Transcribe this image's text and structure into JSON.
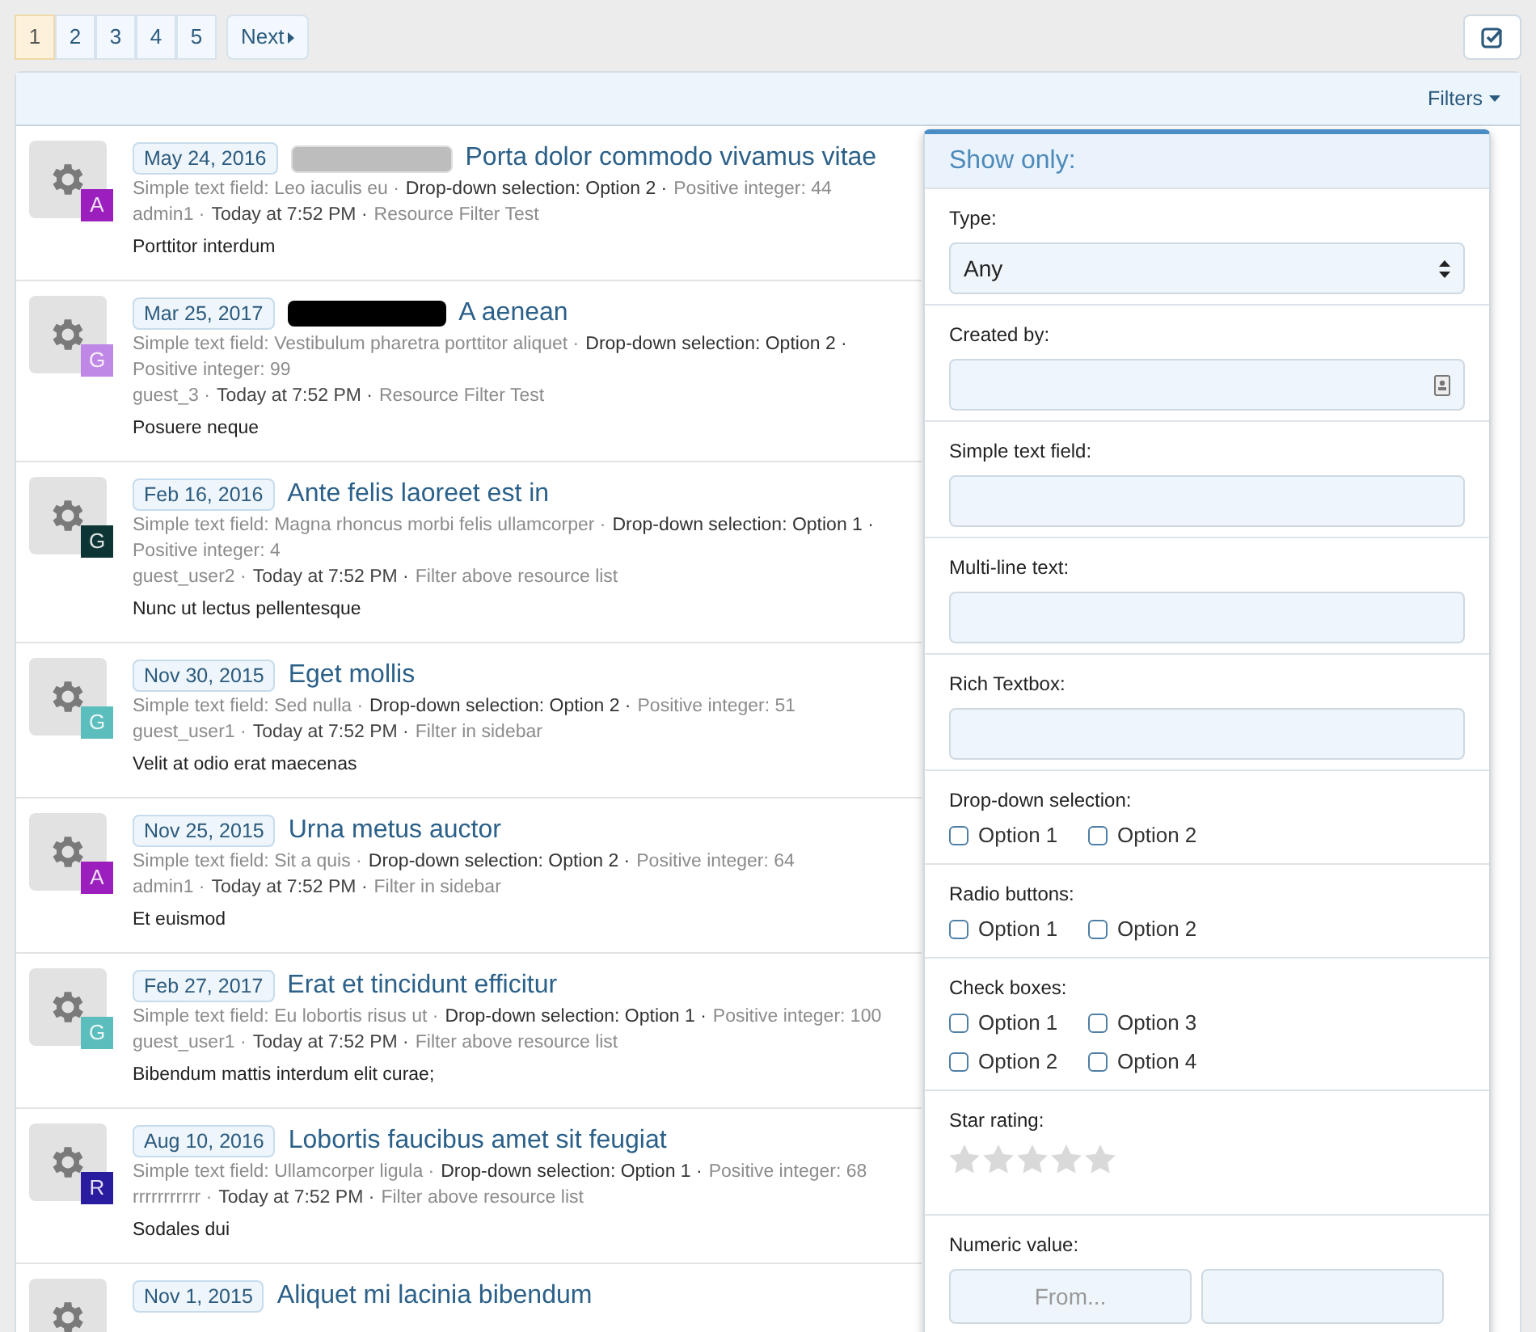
{
  "pagination": {
    "pages": [
      {
        "label": "1",
        "selected": true
      },
      {
        "label": "2",
        "selected": false
      },
      {
        "label": "3",
        "selected": false
      },
      {
        "label": "4",
        "selected": false
      },
      {
        "label": "5",
        "selected": false
      }
    ],
    "next": "Next"
  },
  "filters_toggle": "Filters",
  "resources": [
    {
      "date": "May 24, 2016",
      "redaction": {
        "kind": "light"
      },
      "title": "Porta dolor commodo vivamus vitae",
      "badge": "A",
      "color": "#9a1fbd",
      "fields": [
        {
          "kind": "text",
          "text": "Simple text field: Leo iaculis eu ·"
        },
        {
          "kind": "select",
          "text": "Drop-down selection: Option 2 ·"
        },
        {
          "kind": "integer",
          "text": "Positive integer: 44"
        }
      ],
      "author": "admin1 ·",
      "time": "Today at 7:52 PM ·",
      "category": "Resource Filter Test",
      "tagline": "Porttitor interdum"
    },
    {
      "date": "Mar 25, 2017",
      "redaction": {
        "kind": "dark"
      },
      "title": "A aenean",
      "badge": "G",
      "color": "#c088e6",
      "fields": [
        {
          "kind": "text",
          "text": "Simple text field: Vestibulum pharetra porttitor aliquet ·"
        },
        {
          "kind": "select",
          "text": "Drop-down selection: Option 2 ·"
        },
        {
          "kind": "integer",
          "text": "Positive integer: 99"
        }
      ],
      "author": "guest_3 ·",
      "time": "Today at 7:52 PM ·",
      "category": "Resource Filter Test",
      "tagline": "Posuere neque"
    },
    {
      "date": "Feb 16, 2016",
      "title": "Ante felis laoreet est in",
      "badge": "G",
      "color": "#0e3535",
      "fields": [
        {
          "kind": "text",
          "text": "Simple text field: Magna rhoncus morbi felis ullamcorper ·"
        },
        {
          "kind": "select",
          "text": "Drop-down selection: Option 1 ·"
        },
        {
          "kind": "integer",
          "text": "Positive integer: 4"
        }
      ],
      "author": "guest_user2 ·",
      "time": "Today at 7:52 PM ·",
      "category": "Filter above resource list",
      "tagline": "Nunc ut lectus pellentesque"
    },
    {
      "date": "Nov 30, 2015",
      "title": "Eget mollis",
      "badge": "G",
      "color": "#5cbdbd",
      "fields": [
        {
          "kind": "text",
          "text": "Simple text field: Sed nulla ·"
        },
        {
          "kind": "select",
          "text": "Drop-down selection: Option 2 ·"
        },
        {
          "kind": "integer",
          "text": "Positive integer: 51"
        }
      ],
      "author": "guest_user1 ·",
      "time": "Today at 7:52 PM ·",
      "category": "Filter in sidebar",
      "tagline": "Velit at odio erat maecenas"
    },
    {
      "date": "Nov 25, 2015",
      "title": "Urna metus auctor",
      "badge": "A",
      "color": "#9a1fbd",
      "fields": [
        {
          "kind": "text",
          "text": "Simple text field: Sit a quis ·"
        },
        {
          "kind": "select",
          "text": "Drop-down selection: Option 2 ·"
        },
        {
          "kind": "integer",
          "text": "Positive integer: 64"
        }
      ],
      "author": "admin1 ·",
      "time": "Today at 7:52 PM ·",
      "category": "Filter in sidebar",
      "tagline": "Et euismod"
    },
    {
      "date": "Feb 27, 2017",
      "title": "Erat et tincidunt efficitur",
      "badge": "G",
      "color": "#5cbdbd",
      "fields": [
        {
          "kind": "text",
          "text": "Simple text field: Eu lobortis risus ut ·"
        },
        {
          "kind": "select",
          "text": "Drop-down selection: Option 1 ·"
        },
        {
          "kind": "integer",
          "text": "Positive integer: 100"
        }
      ],
      "author": "guest_user1 ·",
      "time": "Today at 7:52 PM ·",
      "category": "Filter above resource list",
      "tagline": "Bibendum mattis interdum elit curae;"
    },
    {
      "date": "Aug 10, 2016",
      "title": "Lobortis faucibus amet sit feugiat",
      "badge": "R",
      "color": "#2a1c9e",
      "fields": [
        {
          "kind": "text",
          "text": "Simple text field: Ullamcorper ligula ·"
        },
        {
          "kind": "select",
          "text": "Drop-down selection: Option 1 ·"
        },
        {
          "kind": "integer",
          "text": "Positive integer: 68"
        }
      ],
      "author": "rrrrrrrrrrr ·",
      "time": "Today at 7:52 PM ·",
      "category": "Filter above resource list",
      "tagline": "Sodales dui"
    },
    {
      "date": "Nov 1, 2015",
      "title": "Aliquet mi lacinia bibendum"
    }
  ],
  "filter_panel": {
    "title": "Show only:",
    "sections": [
      {
        "kind": "select",
        "label": "Type:",
        "value": "Any"
      },
      {
        "kind": "user",
        "label": "Created by:"
      },
      {
        "kind": "input",
        "label": "Simple text field:"
      },
      {
        "kind": "input",
        "label": "Multi-line text:"
      },
      {
        "kind": "input",
        "label": "Rich Textbox:"
      },
      {
        "kind": "checks",
        "label": "Drop-down selection:",
        "options": [
          {
            "label": "Option 1",
            "checked": false
          },
          {
            "label": "Option 2",
            "checked": false
          }
        ]
      },
      {
        "kind": "checks",
        "label": "Radio buttons:",
        "options": [
          {
            "label": "Option 1",
            "checked": false
          },
          {
            "label": "Option 2",
            "checked": false
          }
        ]
      },
      {
        "kind": "checks",
        "label": "Check boxes:",
        "options": [
          {
            "label": "Option 1",
            "checked": false
          },
          {
            "label": "Option 3",
            "checked": false
          },
          {
            "label": "Option 2",
            "checked": false
          },
          {
            "label": "Option 4",
            "checked": false
          }
        ]
      },
      {
        "kind": "stars",
        "label": "Star rating:",
        "stars": 0
      },
      {
        "kind": "range",
        "label": "Numeric value:",
        "placeholder": "From..."
      }
    ]
  }
}
